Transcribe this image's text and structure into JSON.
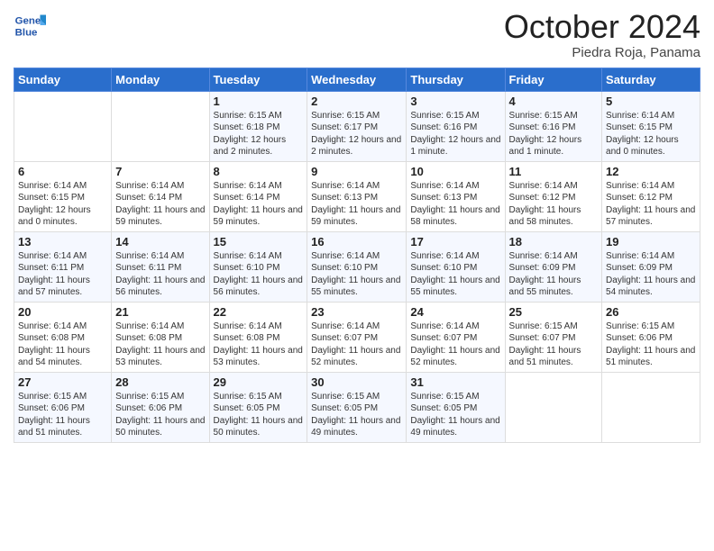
{
  "header": {
    "logo_line1": "General",
    "logo_line2": "Blue",
    "month": "October 2024",
    "location": "Piedra Roja, Panama"
  },
  "days_of_week": [
    "Sunday",
    "Monday",
    "Tuesday",
    "Wednesday",
    "Thursday",
    "Friday",
    "Saturday"
  ],
  "weeks": [
    [
      {
        "day": "",
        "text": ""
      },
      {
        "day": "",
        "text": ""
      },
      {
        "day": "1",
        "text": "Sunrise: 6:15 AM\nSunset: 6:18 PM\nDaylight: 12 hours and 2 minutes."
      },
      {
        "day": "2",
        "text": "Sunrise: 6:15 AM\nSunset: 6:17 PM\nDaylight: 12 hours and 2 minutes."
      },
      {
        "day": "3",
        "text": "Sunrise: 6:15 AM\nSunset: 6:16 PM\nDaylight: 12 hours and 1 minute."
      },
      {
        "day": "4",
        "text": "Sunrise: 6:15 AM\nSunset: 6:16 PM\nDaylight: 12 hours and 1 minute."
      },
      {
        "day": "5",
        "text": "Sunrise: 6:14 AM\nSunset: 6:15 PM\nDaylight: 12 hours and 0 minutes."
      }
    ],
    [
      {
        "day": "6",
        "text": "Sunrise: 6:14 AM\nSunset: 6:15 PM\nDaylight: 12 hours and 0 minutes."
      },
      {
        "day": "7",
        "text": "Sunrise: 6:14 AM\nSunset: 6:14 PM\nDaylight: 11 hours and 59 minutes."
      },
      {
        "day": "8",
        "text": "Sunrise: 6:14 AM\nSunset: 6:14 PM\nDaylight: 11 hours and 59 minutes."
      },
      {
        "day": "9",
        "text": "Sunrise: 6:14 AM\nSunset: 6:13 PM\nDaylight: 11 hours and 59 minutes."
      },
      {
        "day": "10",
        "text": "Sunrise: 6:14 AM\nSunset: 6:13 PM\nDaylight: 11 hours and 58 minutes."
      },
      {
        "day": "11",
        "text": "Sunrise: 6:14 AM\nSunset: 6:12 PM\nDaylight: 11 hours and 58 minutes."
      },
      {
        "day": "12",
        "text": "Sunrise: 6:14 AM\nSunset: 6:12 PM\nDaylight: 11 hours and 57 minutes."
      }
    ],
    [
      {
        "day": "13",
        "text": "Sunrise: 6:14 AM\nSunset: 6:11 PM\nDaylight: 11 hours and 57 minutes."
      },
      {
        "day": "14",
        "text": "Sunrise: 6:14 AM\nSunset: 6:11 PM\nDaylight: 11 hours and 56 minutes."
      },
      {
        "day": "15",
        "text": "Sunrise: 6:14 AM\nSunset: 6:10 PM\nDaylight: 11 hours and 56 minutes."
      },
      {
        "day": "16",
        "text": "Sunrise: 6:14 AM\nSunset: 6:10 PM\nDaylight: 11 hours and 55 minutes."
      },
      {
        "day": "17",
        "text": "Sunrise: 6:14 AM\nSunset: 6:10 PM\nDaylight: 11 hours and 55 minutes."
      },
      {
        "day": "18",
        "text": "Sunrise: 6:14 AM\nSunset: 6:09 PM\nDaylight: 11 hours and 55 minutes."
      },
      {
        "day": "19",
        "text": "Sunrise: 6:14 AM\nSunset: 6:09 PM\nDaylight: 11 hours and 54 minutes."
      }
    ],
    [
      {
        "day": "20",
        "text": "Sunrise: 6:14 AM\nSunset: 6:08 PM\nDaylight: 11 hours and 54 minutes."
      },
      {
        "day": "21",
        "text": "Sunrise: 6:14 AM\nSunset: 6:08 PM\nDaylight: 11 hours and 53 minutes."
      },
      {
        "day": "22",
        "text": "Sunrise: 6:14 AM\nSunset: 6:08 PM\nDaylight: 11 hours and 53 minutes."
      },
      {
        "day": "23",
        "text": "Sunrise: 6:14 AM\nSunset: 6:07 PM\nDaylight: 11 hours and 52 minutes."
      },
      {
        "day": "24",
        "text": "Sunrise: 6:14 AM\nSunset: 6:07 PM\nDaylight: 11 hours and 52 minutes."
      },
      {
        "day": "25",
        "text": "Sunrise: 6:15 AM\nSunset: 6:07 PM\nDaylight: 11 hours and 51 minutes."
      },
      {
        "day": "26",
        "text": "Sunrise: 6:15 AM\nSunset: 6:06 PM\nDaylight: 11 hours and 51 minutes."
      }
    ],
    [
      {
        "day": "27",
        "text": "Sunrise: 6:15 AM\nSunset: 6:06 PM\nDaylight: 11 hours and 51 minutes."
      },
      {
        "day": "28",
        "text": "Sunrise: 6:15 AM\nSunset: 6:06 PM\nDaylight: 11 hours and 50 minutes."
      },
      {
        "day": "29",
        "text": "Sunrise: 6:15 AM\nSunset: 6:05 PM\nDaylight: 11 hours and 50 minutes."
      },
      {
        "day": "30",
        "text": "Sunrise: 6:15 AM\nSunset: 6:05 PM\nDaylight: 11 hours and 49 minutes."
      },
      {
        "day": "31",
        "text": "Sunrise: 6:15 AM\nSunset: 6:05 PM\nDaylight: 11 hours and 49 minutes."
      },
      {
        "day": "",
        "text": ""
      },
      {
        "day": "",
        "text": ""
      }
    ]
  ]
}
